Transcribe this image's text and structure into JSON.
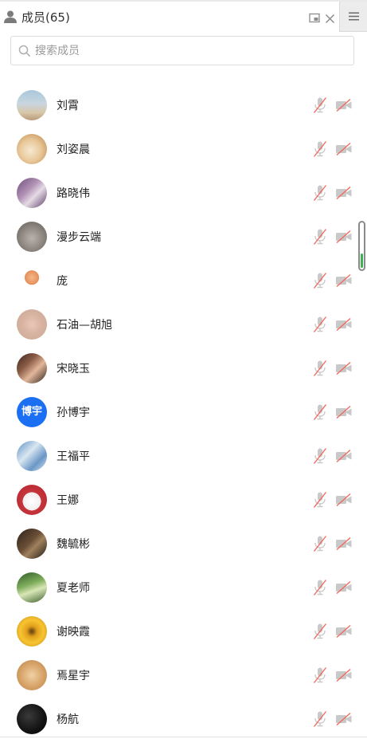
{
  "header": {
    "title": "成员(65)"
  },
  "search": {
    "placeholder": "搜索成员"
  },
  "members": [
    {
      "name": "刘霄",
      "avatar_bg": "linear-gradient(180deg,#a9c7dc 0%,#c9d6df 45%,#d8c6a8 75%,#b79a78 100%)",
      "avatar_text": ""
    },
    {
      "name": "刘姿晨",
      "avatar_bg": "radial-gradient(circle at 45% 55%,#f6e9d2 0%,#e9c89a 45%,#cfa46e 75%,#8f6a45 100%)",
      "avatar_text": ""
    },
    {
      "name": "路晓伟",
      "avatar_bg": "linear-gradient(135deg,#6f4b7a 0%,#b293b6 40%,#e5dbe6 60%,#5a3a64 100%)",
      "avatar_text": ""
    },
    {
      "name": "漫步云端",
      "avatar_bg": "radial-gradient(circle at 50% 55%,#b9b3ad 0%,#8e8781 50%,#5e5955 100%)",
      "avatar_text": ""
    },
    {
      "name": "庞",
      "avatar_bg": "radial-gradient(circle at 50% 40%,#f4b98a 0%,#e68f5a 30%,#ffffff 31%,#ffffff 100%)",
      "avatar_text": ""
    },
    {
      "name": "石油—胡旭",
      "avatar_bg": "radial-gradient(circle at 50% 50%,#e9c7b8 0%,#d8b3a2 45%,#c9a896 100%)",
      "avatar_text": ""
    },
    {
      "name": "宋晓玉",
      "avatar_bg": "linear-gradient(135deg,#3a2620 0%,#8a5b45 35%,#e2b79a 60%,#2a1c18 100%)",
      "avatar_text": ""
    },
    {
      "name": "孙博宇",
      "avatar_bg": "#1b6ff2",
      "avatar_text": "博宇"
    },
    {
      "name": "王福平",
      "avatar_bg": "linear-gradient(135deg,#5d8fc4 0%,#d9e6f1 40%,#6a97c6 70%,#dbe7f2 100%)",
      "avatar_text": ""
    },
    {
      "name": "王娜",
      "avatar_bg": "radial-gradient(circle at 50% 55%,#ffffff 0%,#f2eeee 40%,#c6343c 41%,#b5262f 100%)",
      "avatar_text": ""
    },
    {
      "name": "魏毓彬",
      "avatar_bg": "linear-gradient(135deg,#2b2118 0%,#6b4f37 45%,#a0815e 60%,#1f1913 100%)",
      "avatar_text": ""
    },
    {
      "name": "夏老师",
      "avatar_bg": "linear-gradient(160deg,#2f5a2a 0%,#7fae5c 40%,#d9e6b7 60%,#3b5f2c 100%)",
      "avatar_text": ""
    },
    {
      "name": "谢映霞",
      "avatar_bg": "radial-gradient(circle at 50% 50%,#5a3b12 0%,#e2a01c 25%,#f7c531 55%,#c47f12 100%)",
      "avatar_text": ""
    },
    {
      "name": "焉星宇",
      "avatar_bg": "radial-gradient(circle at 50% 50%,#f0d1a6 0%,#d9a66c 50%,#b78248 100%)",
      "avatar_text": ""
    },
    {
      "name": "杨航",
      "avatar_bg": "radial-gradient(circle at 40% 40%,#3a3a3a 0%,#121212 60%,#050505 100%)",
      "avatar_text": ""
    }
  ]
}
